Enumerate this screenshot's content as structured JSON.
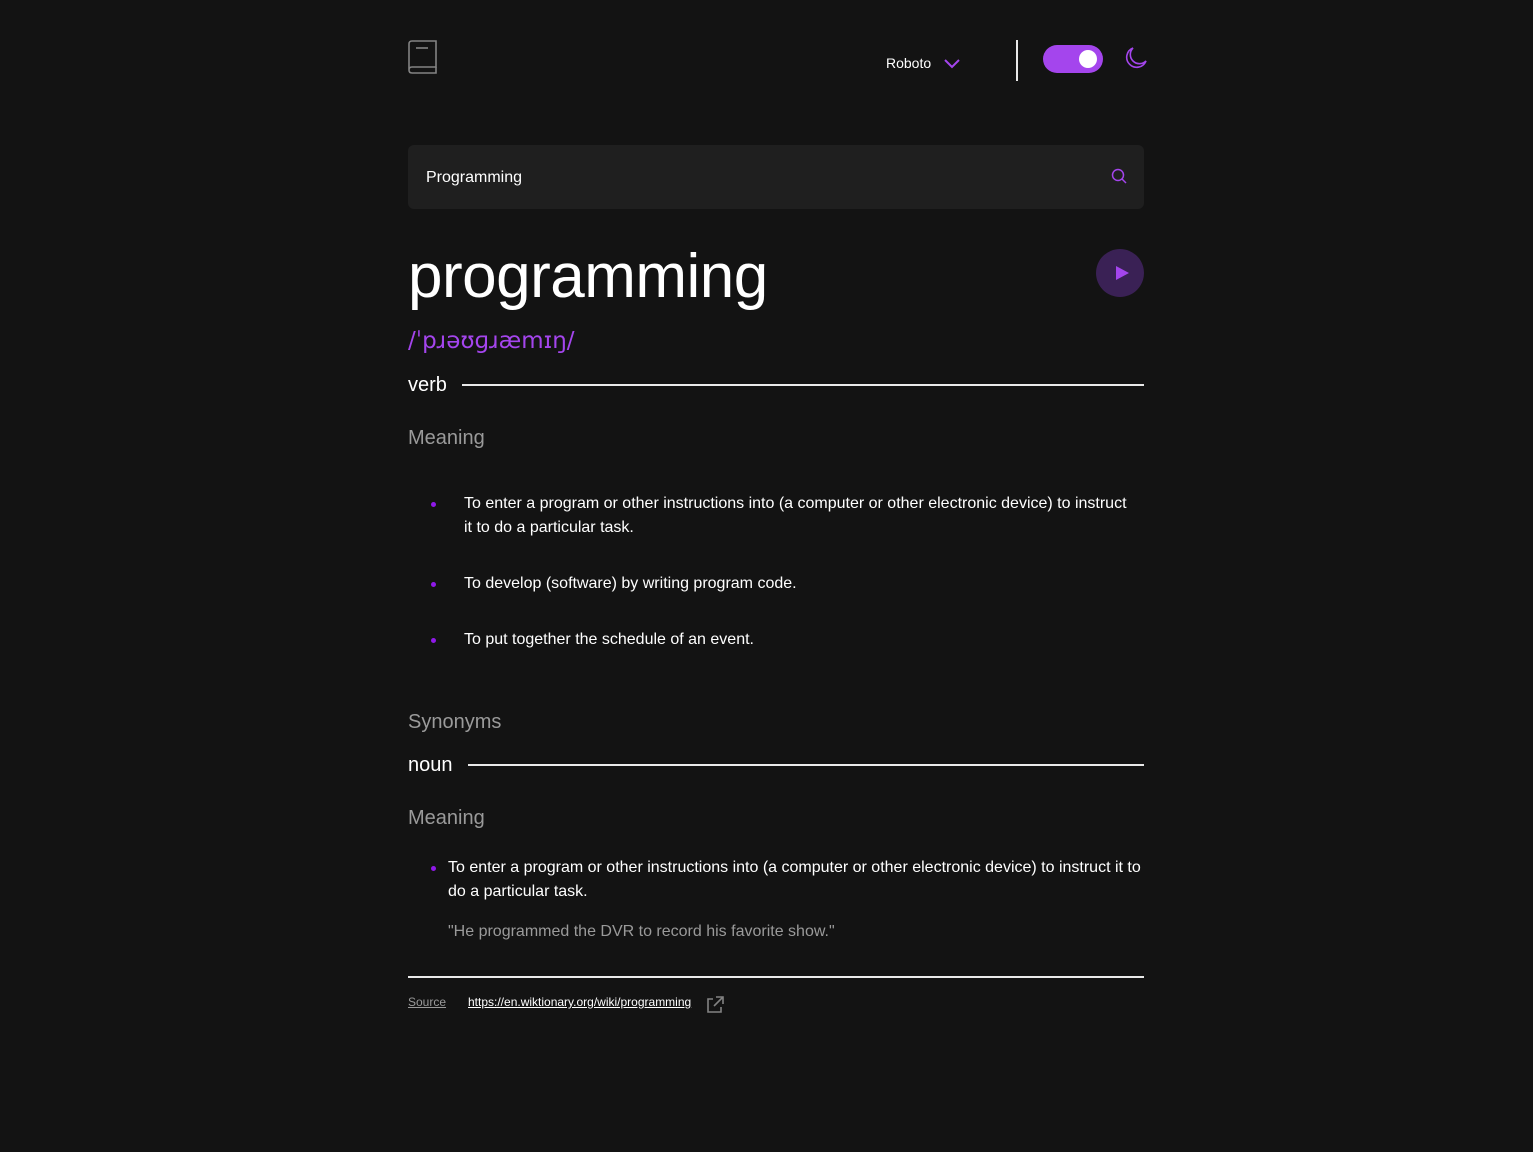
{
  "header": {
    "logo_icon": "book-icon",
    "font_select": {
      "selected": "Roboto",
      "icon": "chevron-down-icon"
    },
    "theme_toggle": {
      "state": "on",
      "icon": "moon-icon"
    },
    "accent_color": "#a445ed"
  },
  "search": {
    "value": "Programming",
    "icon": "search-icon"
  },
  "entry": {
    "word": "programming",
    "phonetic": "/ˈpɹəʊɡɹæmɪŋ/",
    "play_icon": "play-icon"
  },
  "meanings": [
    {
      "part_of_speech": "verb",
      "meaning_label": "Meaning",
      "definitions": [
        "To enter a program or other instructions into (a computer or other electronic device) to instruct it to do a particular task.",
        "To develop (software) by writing program code.",
        "To put together the schedule of an event."
      ],
      "synonyms_label": "Synonyms"
    },
    {
      "part_of_speech": "noun",
      "meaning_label": "Meaning",
      "definitions": [
        "To enter a program or other instructions into (a computer or other electronic device) to instruct it to do a particular task."
      ],
      "example": "\"He programmed the DVR to record his favorite show.\""
    }
  ],
  "footer": {
    "source_label": "Source",
    "source_url": "https://en.wiktionary.org/wiki/programming",
    "link_icon": "external-link-icon"
  }
}
